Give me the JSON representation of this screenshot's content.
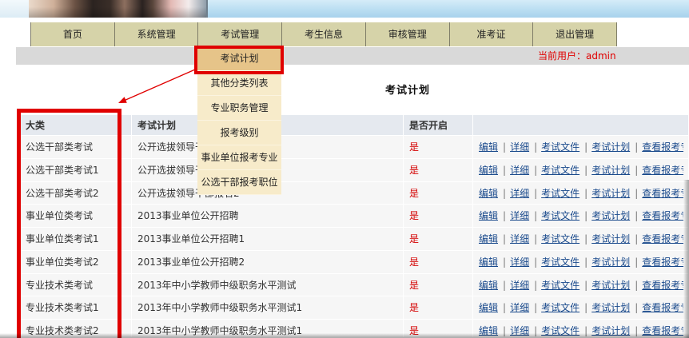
{
  "nav": {
    "items": [
      "首页",
      "系统管理",
      "考试管理",
      "考生信息",
      "审核管理",
      "准考证",
      "退出管理"
    ]
  },
  "user_bar": {
    "current_user": "当前用户：admin"
  },
  "exam_menu": {
    "items": [
      "考试计划",
      "其他分类列表",
      "专业职务管理",
      "报考级别",
      "事业单位报考专业",
      "公选干部报考职位"
    ],
    "active_index": 0
  },
  "page_title": "考试计划",
  "table": {
    "headers": [
      "大类",
      "考试计划",
      "是否开启"
    ],
    "actions": [
      "编辑",
      "详细",
      "考试文件",
      "考试计划",
      "查看报考专"
    ],
    "separator": "|",
    "rows": [
      {
        "category": "公选干部类考试",
        "plan": "公开选拔领导干",
        "enabled": "是"
      },
      {
        "category": "公选干部类考试1",
        "plan": "公开选拔领导干",
        "enabled": "是"
      },
      {
        "category": "公选干部类考试2",
        "plan": "公开选拔领导干部报名2",
        "enabled": "是"
      },
      {
        "category": "事业单位类考试",
        "plan": "2013事业单位公开招聘",
        "enabled": "是"
      },
      {
        "category": "事业单位类考试1",
        "plan": "2013事业单位公开招聘1",
        "enabled": "是"
      },
      {
        "category": "事业单位类考试2",
        "plan": "2013事业单位公开招聘2",
        "enabled": "是"
      },
      {
        "category": "专业技术类考试",
        "plan": "2013年中小学教师中级职务水平测试",
        "enabled": "是"
      },
      {
        "category": "专业技术类考试1",
        "plan": "2013年中小学教师中级职务水平测试1",
        "enabled": "是"
      },
      {
        "category": "专业技术类考试2",
        "plan": "2013年中小学教师中级职务水平测试1",
        "enabled": "是"
      }
    ]
  },
  "colors": {
    "nav_bg": "#d6d3a9",
    "menu_bg": "#f7ebca",
    "menu_active_bg": "#e6c489",
    "header_bg": "#e5e9ef",
    "link": "#1a4a8c",
    "accent_red": "#e00000",
    "user_bar_bg": "#d9d9d9"
  }
}
